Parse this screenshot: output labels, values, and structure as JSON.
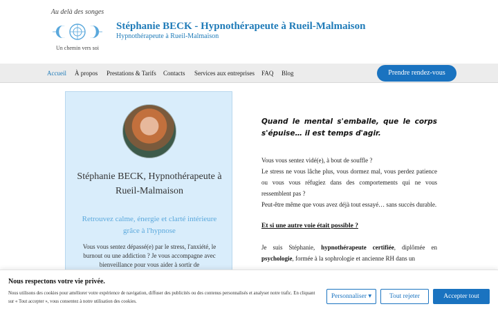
{
  "logo": {
    "arc_text": "Au delà des songes",
    "tagline": "Un chemin vers soi"
  },
  "site": {
    "title": "Stéphanie BECK - Hypnothérapeute à Rueil-Malmaison",
    "tagline": "Hypnothérapeute à Rueil-Malmaison"
  },
  "nav": {
    "items": [
      {
        "label": "Accueil"
      },
      {
        "label": "À propos"
      },
      {
        "label": "Prestations & Tarifs"
      },
      {
        "label": "Contacts"
      },
      {
        "label": "Services aux entreprises"
      },
      {
        "label": "FAQ"
      },
      {
        "label": "Blog"
      }
    ],
    "cta_label": "Prendre rendez-vous"
  },
  "card": {
    "name": "Stéphanie BECK, Hypnothérapeute à Rueil-Malmaison",
    "subtitle": "Retrouvez calme, énergie et clarté intérieure grâce à l'hypnose",
    "body": "Vous vous sentez dépassé(e) par le stress, l'anxiété, le burnout ou une addiction ? Je vous accompagne avec bienveillance pour vous aider à sortir de"
  },
  "content": {
    "quote": "Quand le mental s'emballe, que le corps s'épuise… il est temps d'agir.",
    "p1": "Vous vous sentez vidé(e), à bout de souffle ?",
    "p2": "Le stress ne vous lâche plus, vous dormez mal, vous perdez patience ou vous vous réfugiez dans des comportements qui ne vous ressemblent pas ?",
    "p3": "Peut-être même que vous avez déjà tout essayé… sans succès durable.",
    "heading": "Et si une autre voie était possible ?",
    "intro_a": "Je suis Stéphanie, ",
    "intro_b": "hypnothérapeute certifiée",
    "intro_c": ", diplômée en ",
    "intro_d": "psychologie",
    "intro_e": ", formée à la sophrologie et ancienne RH dans un"
  },
  "cookie": {
    "title": "Nous respectons votre vie privée.",
    "text": "Nous utilisons des cookies pour améliorer votre expérience de navigation, diffuser des publicités ou des contenus personnalisés et analyser notre trafic. En cliquant sur « Tout accepter », vous consentez à notre utilisation des cookies.",
    "customize": "Personnaliser",
    "reject": "Tout rejeter",
    "accept": "Accepter tout"
  },
  "colors": {
    "accent": "#1a73c0",
    "title": "#1f7bb8",
    "card_bg": "#d9edfb",
    "subtitle": "#5aa8dc"
  }
}
